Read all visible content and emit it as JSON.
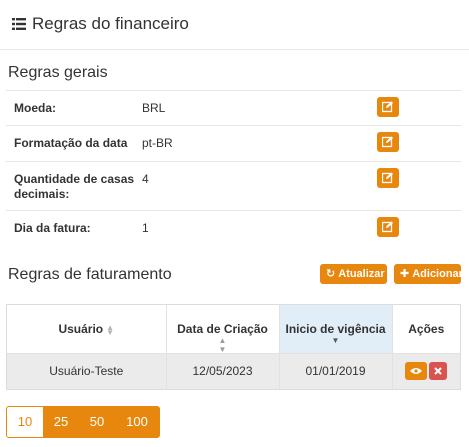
{
  "header": {
    "title": "Regras do financeiro",
    "icon": "list-icon"
  },
  "general": {
    "title": "Regras gerais",
    "rows": [
      {
        "label": "Moeda:",
        "value": "BRL"
      },
      {
        "label": "Formatação da data",
        "value": "pt-BR"
      },
      {
        "label": "Quantidade de casas decimais:",
        "value": "4"
      },
      {
        "label": "Dia da fatura:",
        "value": "1"
      }
    ]
  },
  "billing": {
    "title": "Regras de faturamento",
    "refresh_label": "Atualizar",
    "add_label": "Adicionar",
    "columns": [
      "Usuário",
      "Data de Criação",
      "Inicio de vigência",
      "Ações"
    ],
    "rows": [
      {
        "user": "Usuário-Teste",
        "created": "12/05/2023",
        "start": "01/01/2019"
      }
    ]
  },
  "pagination": {
    "options": [
      "10",
      "25",
      "50",
      "100"
    ],
    "selected": "10"
  },
  "colors": {
    "accent": "#e8870d",
    "danger": "#d9534f",
    "sorted_header": "#e1edf7"
  }
}
